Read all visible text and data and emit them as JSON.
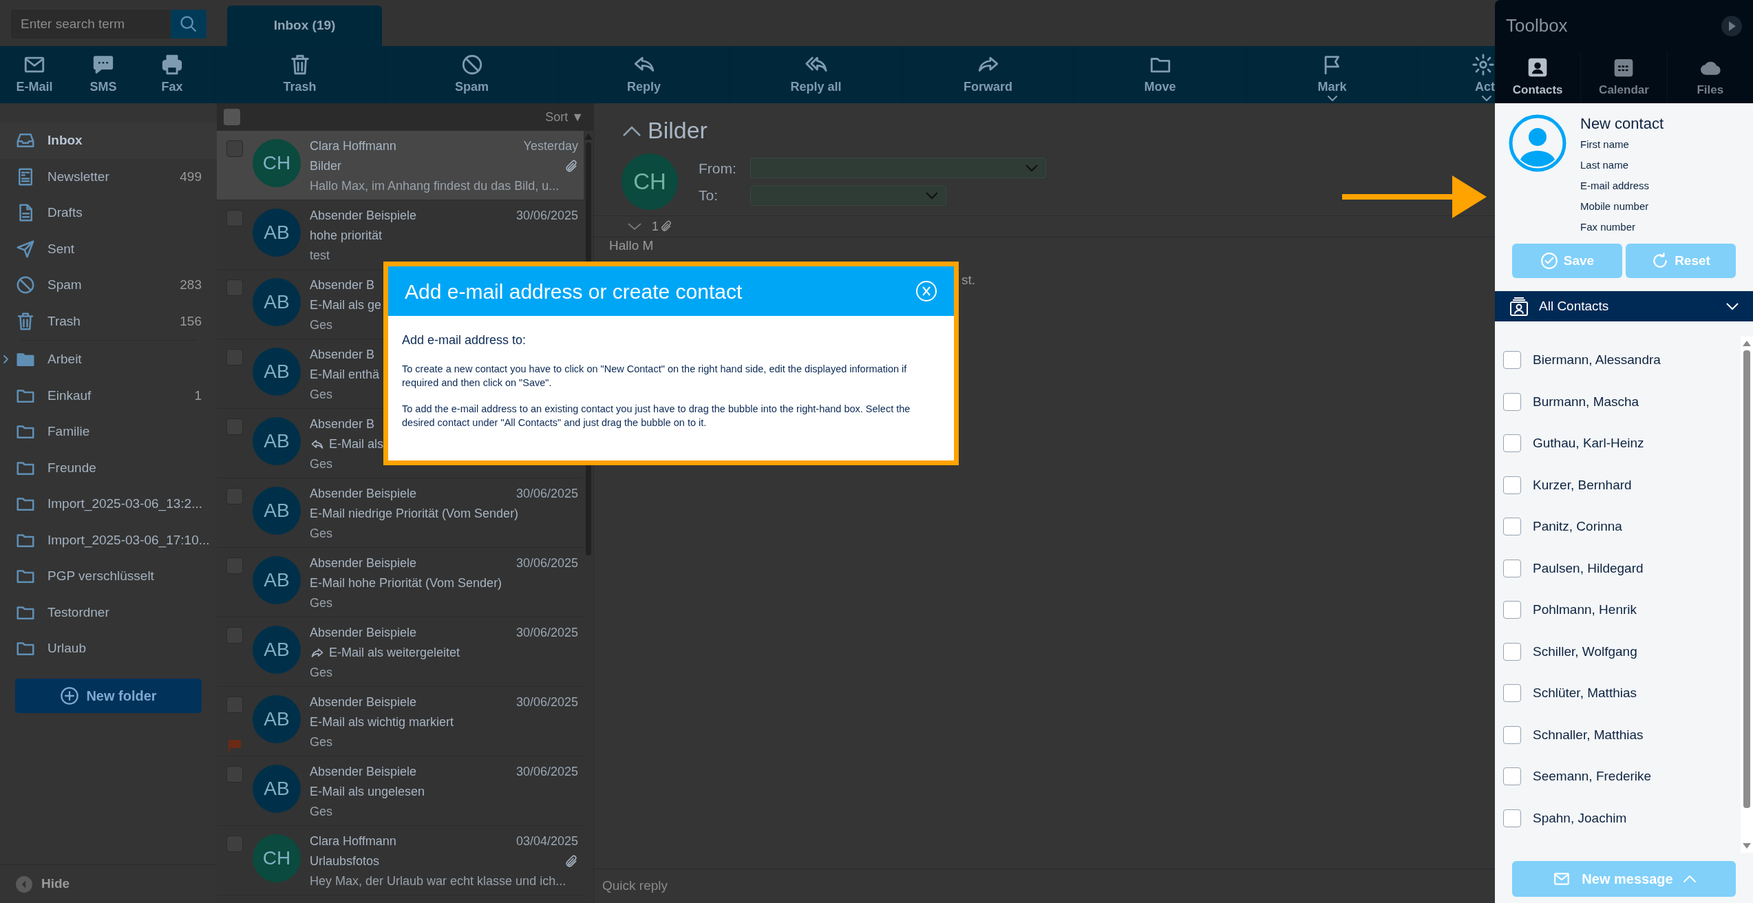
{
  "search": {
    "placeholder": "Enter search term"
  },
  "tabs": [
    {
      "label": "Inbox (19)",
      "selected": true
    }
  ],
  "toolbar": [
    {
      "label": "E-Mail",
      "dropdown": false
    },
    {
      "label": "SMS",
      "dropdown": false
    },
    {
      "label": "Fax",
      "dropdown": false
    },
    {
      "label": "Trash",
      "dropdown": false
    },
    {
      "label": "Spam",
      "dropdown": false
    },
    {
      "label": "Reply",
      "dropdown": false
    },
    {
      "label": "Reply all",
      "dropdown": false
    },
    {
      "label": "Forward",
      "dropdown": false
    },
    {
      "label": "Move",
      "dropdown": false
    },
    {
      "label": "Mark",
      "dropdown": true
    },
    {
      "label": "Act",
      "dropdown": true
    }
  ],
  "sidebar": {
    "items": [
      {
        "label": "Inbox",
        "selected": true,
        "expandable": false
      },
      {
        "label": "Newsletter",
        "count": "499",
        "selected": false,
        "expandable": false
      },
      {
        "label": "Drafts",
        "selected": false,
        "expandable": false
      },
      {
        "label": "Sent",
        "selected": false,
        "expandable": false
      },
      {
        "label": "Spam",
        "count": "283",
        "selected": false,
        "expandable": false
      },
      {
        "label": "Trash",
        "count": "156",
        "selected": false,
        "expandable": false
      },
      {
        "label": "Arbeit",
        "selected": false,
        "expandable": true
      },
      {
        "label": "Einkauf",
        "count": "1",
        "selected": false,
        "expandable": false
      },
      {
        "label": "Familie",
        "selected": false,
        "expandable": false
      },
      {
        "label": "Freunde",
        "selected": false,
        "expandable": false
      },
      {
        "label": "Import_2025-03-06_13:2...",
        "selected": false,
        "expandable": false
      },
      {
        "label": "Import_2025-03-06_17:10...",
        "selected": false,
        "expandable": false
      },
      {
        "label": "PGP verschlüsselt",
        "selected": false,
        "expandable": false
      },
      {
        "label": "Testordner",
        "selected": false,
        "expandable": false
      },
      {
        "label": "Urlaub",
        "selected": false,
        "expandable": false
      }
    ],
    "new_folder": "New folder",
    "hide": "Hide"
  },
  "mail_list": {
    "select_all": {
      "checked": false
    },
    "sort": "Sort ▼",
    "rows": [
      {
        "initials": "CH",
        "color": "#0b4a3e",
        "sender": "Clara Hoffmann",
        "date": "Yesterday",
        "subject": "Bilder",
        "preview": "Hallo Max, im Anhang findest du das Bild, u...",
        "selected": true,
        "checked": false,
        "attachment": true,
        "flagged": false,
        "replied": false,
        "forwarded": false
      },
      {
        "initials": "AB",
        "color": "#003049",
        "sender": "Absender Beispiele",
        "date": "30/06/2025",
        "subject": "hohe priorität",
        "preview": "test",
        "selected": false,
        "checked": false,
        "attachment": false,
        "flagged": false,
        "replied": false,
        "forwarded": false
      },
      {
        "initials": "AB",
        "color": "#003049",
        "sender": "Absender B",
        "subject": "E-Mail als ge",
        "preview": "Ges",
        "selected": false,
        "checked": false,
        "attachment": false,
        "flagged": false,
        "replied": false,
        "forwarded": false
      },
      {
        "initials": "AB",
        "color": "#003049",
        "sender": "Absender B",
        "subject": "E-Mail enthä",
        "preview": "Ges",
        "selected": false,
        "checked": false,
        "attachment": false,
        "flagged": false,
        "replied": false,
        "forwarded": false
      },
      {
        "initials": "AB",
        "color": "#003049",
        "sender": "Absender B",
        "subject": "E-Mail als",
        "preview": "Ges",
        "selected": false,
        "checked": false,
        "attachment": false,
        "flagged": false,
        "replied": true,
        "forwarded": false
      },
      {
        "initials": "AB",
        "color": "#003049",
        "sender": "Absender Beispiele",
        "date": "30/06/2025",
        "subject": "E-Mail niedrige Priorität (Vom Sender)",
        "preview": "Ges",
        "selected": false,
        "checked": false,
        "attachment": false,
        "flagged": false,
        "replied": false,
        "forwarded": false
      },
      {
        "initials": "AB",
        "color": "#003049",
        "sender": "Absender Beispiele",
        "date": "30/06/2025",
        "subject": "E-Mail hohe Priorität (Vom Sender)",
        "preview": "Ges",
        "selected": false,
        "checked": false,
        "attachment": false,
        "flagged": false,
        "replied": false,
        "forwarded": false
      },
      {
        "initials": "AB",
        "color": "#003049",
        "sender": "Absender Beispiele",
        "date": "30/06/2025",
        "subject": "E-Mail als weitergeleitet",
        "preview": "Ges",
        "selected": false,
        "checked": false,
        "attachment": false,
        "flagged": false,
        "replied": false,
        "forwarded": true
      },
      {
        "initials": "AB",
        "color": "#003049",
        "sender": "Absender Beispiele",
        "date": "30/06/2025",
        "subject": "E-Mail als wichtig markiert",
        "preview": "Ges",
        "selected": false,
        "checked": false,
        "attachment": false,
        "flagged": true,
        "replied": false,
        "forwarded": false
      },
      {
        "initials": "AB",
        "color": "#003049",
        "sender": "Absender Beispiele",
        "date": "30/06/2025",
        "subject": "E-Mail als ungelesen",
        "preview": "Ges",
        "selected": false,
        "checked": false,
        "attachment": false,
        "flagged": false,
        "replied": false,
        "forwarded": false
      },
      {
        "initials": "CH",
        "color": "#0b4a3e",
        "sender": "Clara Hoffmann",
        "date": "03/04/2025",
        "subject": "Urlaubsfotos",
        "preview": "Hey Max, der Urlaub war echt klasse und ich...",
        "selected": false,
        "checked": false,
        "attachment": true,
        "flagged": false,
        "replied": false,
        "forwarded": false
      }
    ]
  },
  "message": {
    "title": "Bilder",
    "initials": "CH",
    "from_label": "From:",
    "to_label": "To:",
    "attachment_count": "1",
    "body": [
      "Hallo M",
      "st."
    ],
    "quick_reply": {
      "placeholder": "Quick reply"
    }
  },
  "dialog": {
    "title": "Add e-mail address or create contact",
    "heading": "Add e-mail address to:",
    "paragraphs": [
      "To create a new contact you have to click on \"New Contact\" on the right hand side, edit the displayed information if required and then click on \"Save\".",
      "To add the e-mail address to an existing contact you just have to drag the bubble into the right-hand box. Select the desired contact under \"All Contacts\" and just drag the bubble on to it."
    ]
  },
  "toolbox": {
    "title": "Toolbox",
    "tabs": [
      {
        "label": "Contacts",
        "selected": true
      },
      {
        "label": "Calendar",
        "selected": false
      },
      {
        "label": "Files",
        "selected": false
      }
    ],
    "new_contact": {
      "title": "New contact",
      "fields": [
        {
          "placeholder": "First name"
        },
        {
          "placeholder": "Last name"
        },
        {
          "placeholder": "E-mail address"
        },
        {
          "placeholder": "Mobile number"
        },
        {
          "placeholder": "Fax number"
        }
      ],
      "buttons": [
        "Save",
        "Reset"
      ]
    },
    "contacts_header": "All Contacts",
    "contacts": [
      {
        "name": "Biermann, Alessandra",
        "checked": false
      },
      {
        "name": "Burmann, Mascha",
        "checked": false
      },
      {
        "name": "Guthau, Karl-Heinz",
        "checked": false
      },
      {
        "name": "Kurzer, Bernhard",
        "checked": false
      },
      {
        "name": "Panitz, Corinna",
        "checked": false
      },
      {
        "name": "Paulsen, Hildegard",
        "checked": false
      },
      {
        "name": "Pohlmann, Henrik",
        "checked": false
      },
      {
        "name": "Schiller, Wolfgang",
        "checked": false
      },
      {
        "name": "Schlüter, Matthias",
        "checked": false
      },
      {
        "name": "Schnaller, Matthias",
        "checked": false
      },
      {
        "name": "Seemann, Frederike",
        "checked": false
      },
      {
        "name": "Spahn, Joachim",
        "checked": false
      }
    ],
    "new_message": "New message"
  }
}
